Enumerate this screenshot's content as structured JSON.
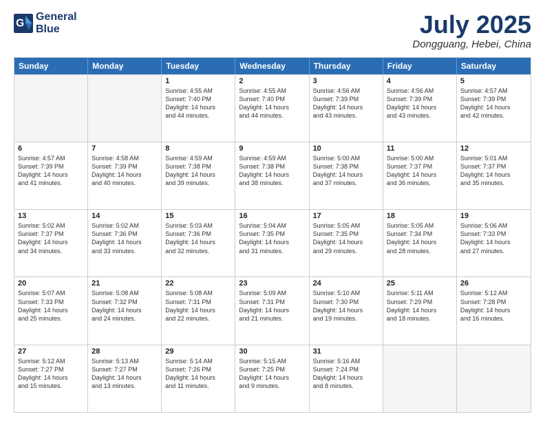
{
  "header": {
    "logo_line1": "General",
    "logo_line2": "Blue",
    "month_year": "July 2025",
    "location": "Dongguang, Hebei, China"
  },
  "weekdays": [
    "Sunday",
    "Monday",
    "Tuesday",
    "Wednesday",
    "Thursday",
    "Friday",
    "Saturday"
  ],
  "weeks": [
    [
      {
        "day": "",
        "info": "",
        "empty": true
      },
      {
        "day": "",
        "info": "",
        "empty": true
      },
      {
        "day": "1",
        "info": "Sunrise: 4:55 AM\nSunset: 7:40 PM\nDaylight: 14 hours\nand 44 minutes.",
        "empty": false
      },
      {
        "day": "2",
        "info": "Sunrise: 4:55 AM\nSunset: 7:40 PM\nDaylight: 14 hours\nand 44 minutes.",
        "empty": false
      },
      {
        "day": "3",
        "info": "Sunrise: 4:56 AM\nSunset: 7:39 PM\nDaylight: 14 hours\nand 43 minutes.",
        "empty": false
      },
      {
        "day": "4",
        "info": "Sunrise: 4:56 AM\nSunset: 7:39 PM\nDaylight: 14 hours\nand 43 minutes.",
        "empty": false
      },
      {
        "day": "5",
        "info": "Sunrise: 4:57 AM\nSunset: 7:39 PM\nDaylight: 14 hours\nand 42 minutes.",
        "empty": false
      }
    ],
    [
      {
        "day": "6",
        "info": "Sunrise: 4:57 AM\nSunset: 7:39 PM\nDaylight: 14 hours\nand 41 minutes.",
        "empty": false
      },
      {
        "day": "7",
        "info": "Sunrise: 4:58 AM\nSunset: 7:39 PM\nDaylight: 14 hours\nand 40 minutes.",
        "empty": false
      },
      {
        "day": "8",
        "info": "Sunrise: 4:59 AM\nSunset: 7:38 PM\nDaylight: 14 hours\nand 39 minutes.",
        "empty": false
      },
      {
        "day": "9",
        "info": "Sunrise: 4:59 AM\nSunset: 7:38 PM\nDaylight: 14 hours\nand 38 minutes.",
        "empty": false
      },
      {
        "day": "10",
        "info": "Sunrise: 5:00 AM\nSunset: 7:38 PM\nDaylight: 14 hours\nand 37 minutes.",
        "empty": false
      },
      {
        "day": "11",
        "info": "Sunrise: 5:00 AM\nSunset: 7:37 PM\nDaylight: 14 hours\nand 36 minutes.",
        "empty": false
      },
      {
        "day": "12",
        "info": "Sunrise: 5:01 AM\nSunset: 7:37 PM\nDaylight: 14 hours\nand 35 minutes.",
        "empty": false
      }
    ],
    [
      {
        "day": "13",
        "info": "Sunrise: 5:02 AM\nSunset: 7:37 PM\nDaylight: 14 hours\nand 34 minutes.",
        "empty": false
      },
      {
        "day": "14",
        "info": "Sunrise: 5:02 AM\nSunset: 7:36 PM\nDaylight: 14 hours\nand 33 minutes.",
        "empty": false
      },
      {
        "day": "15",
        "info": "Sunrise: 5:03 AM\nSunset: 7:36 PM\nDaylight: 14 hours\nand 32 minutes.",
        "empty": false
      },
      {
        "day": "16",
        "info": "Sunrise: 5:04 AM\nSunset: 7:35 PM\nDaylight: 14 hours\nand 31 minutes.",
        "empty": false
      },
      {
        "day": "17",
        "info": "Sunrise: 5:05 AM\nSunset: 7:35 PM\nDaylight: 14 hours\nand 29 minutes.",
        "empty": false
      },
      {
        "day": "18",
        "info": "Sunrise: 5:05 AM\nSunset: 7:34 PM\nDaylight: 14 hours\nand 28 minutes.",
        "empty": false
      },
      {
        "day": "19",
        "info": "Sunrise: 5:06 AM\nSunset: 7:33 PM\nDaylight: 14 hours\nand 27 minutes.",
        "empty": false
      }
    ],
    [
      {
        "day": "20",
        "info": "Sunrise: 5:07 AM\nSunset: 7:33 PM\nDaylight: 14 hours\nand 25 minutes.",
        "empty": false
      },
      {
        "day": "21",
        "info": "Sunrise: 5:08 AM\nSunset: 7:32 PM\nDaylight: 14 hours\nand 24 minutes.",
        "empty": false
      },
      {
        "day": "22",
        "info": "Sunrise: 5:08 AM\nSunset: 7:31 PM\nDaylight: 14 hours\nand 22 minutes.",
        "empty": false
      },
      {
        "day": "23",
        "info": "Sunrise: 5:09 AM\nSunset: 7:31 PM\nDaylight: 14 hours\nand 21 minutes.",
        "empty": false
      },
      {
        "day": "24",
        "info": "Sunrise: 5:10 AM\nSunset: 7:30 PM\nDaylight: 14 hours\nand 19 minutes.",
        "empty": false
      },
      {
        "day": "25",
        "info": "Sunrise: 5:11 AM\nSunset: 7:29 PM\nDaylight: 14 hours\nand 18 minutes.",
        "empty": false
      },
      {
        "day": "26",
        "info": "Sunrise: 5:12 AM\nSunset: 7:28 PM\nDaylight: 14 hours\nand 16 minutes.",
        "empty": false
      }
    ],
    [
      {
        "day": "27",
        "info": "Sunrise: 5:12 AM\nSunset: 7:27 PM\nDaylight: 14 hours\nand 15 minutes.",
        "empty": false
      },
      {
        "day": "28",
        "info": "Sunrise: 5:13 AM\nSunset: 7:27 PM\nDaylight: 14 hours\nand 13 minutes.",
        "empty": false
      },
      {
        "day": "29",
        "info": "Sunrise: 5:14 AM\nSunset: 7:26 PM\nDaylight: 14 hours\nand 11 minutes.",
        "empty": false
      },
      {
        "day": "30",
        "info": "Sunrise: 5:15 AM\nSunset: 7:25 PM\nDaylight: 14 hours\nand 9 minutes.",
        "empty": false
      },
      {
        "day": "31",
        "info": "Sunrise: 5:16 AM\nSunset: 7:24 PM\nDaylight: 14 hours\nand 8 minutes.",
        "empty": false
      },
      {
        "day": "",
        "info": "",
        "empty": true
      },
      {
        "day": "",
        "info": "",
        "empty": true
      }
    ]
  ]
}
